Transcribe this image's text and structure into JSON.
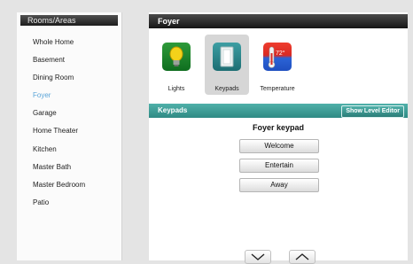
{
  "sidebar": {
    "title": "Rooms/Areas",
    "items": [
      "Whole Home",
      "Basement",
      "Dining Room",
      "Foyer",
      "Garage",
      "Home Theater",
      "Kitchen",
      "Master Bath",
      "Master Bedroom",
      "Patio"
    ],
    "active_item": "Foyer",
    "active_color": "#5aa4d8"
  },
  "room_header": {
    "title": "Foyer"
  },
  "device_tiles": [
    {
      "label": "Lights",
      "icon": "lightbulb-icon"
    },
    {
      "label": "Keypads",
      "icon": "keypad-icon",
      "selected": true
    },
    {
      "label": "Temperature",
      "icon": "thermometer-icon",
      "temperature": "72°"
    }
  ],
  "keypads_section": {
    "title": "Keypads",
    "level_editor_button": "Show Level Editor",
    "keypad_title": "Foyer keypad",
    "buttons": [
      "Welcome",
      "Entertain",
      "Away"
    ]
  },
  "navigation": {
    "down": "chevron-down-icon",
    "up": "chevron-up-icon"
  },
  "colors": {
    "section_bar": "#3d9c96",
    "header_bar": "#1d1d1d"
  }
}
